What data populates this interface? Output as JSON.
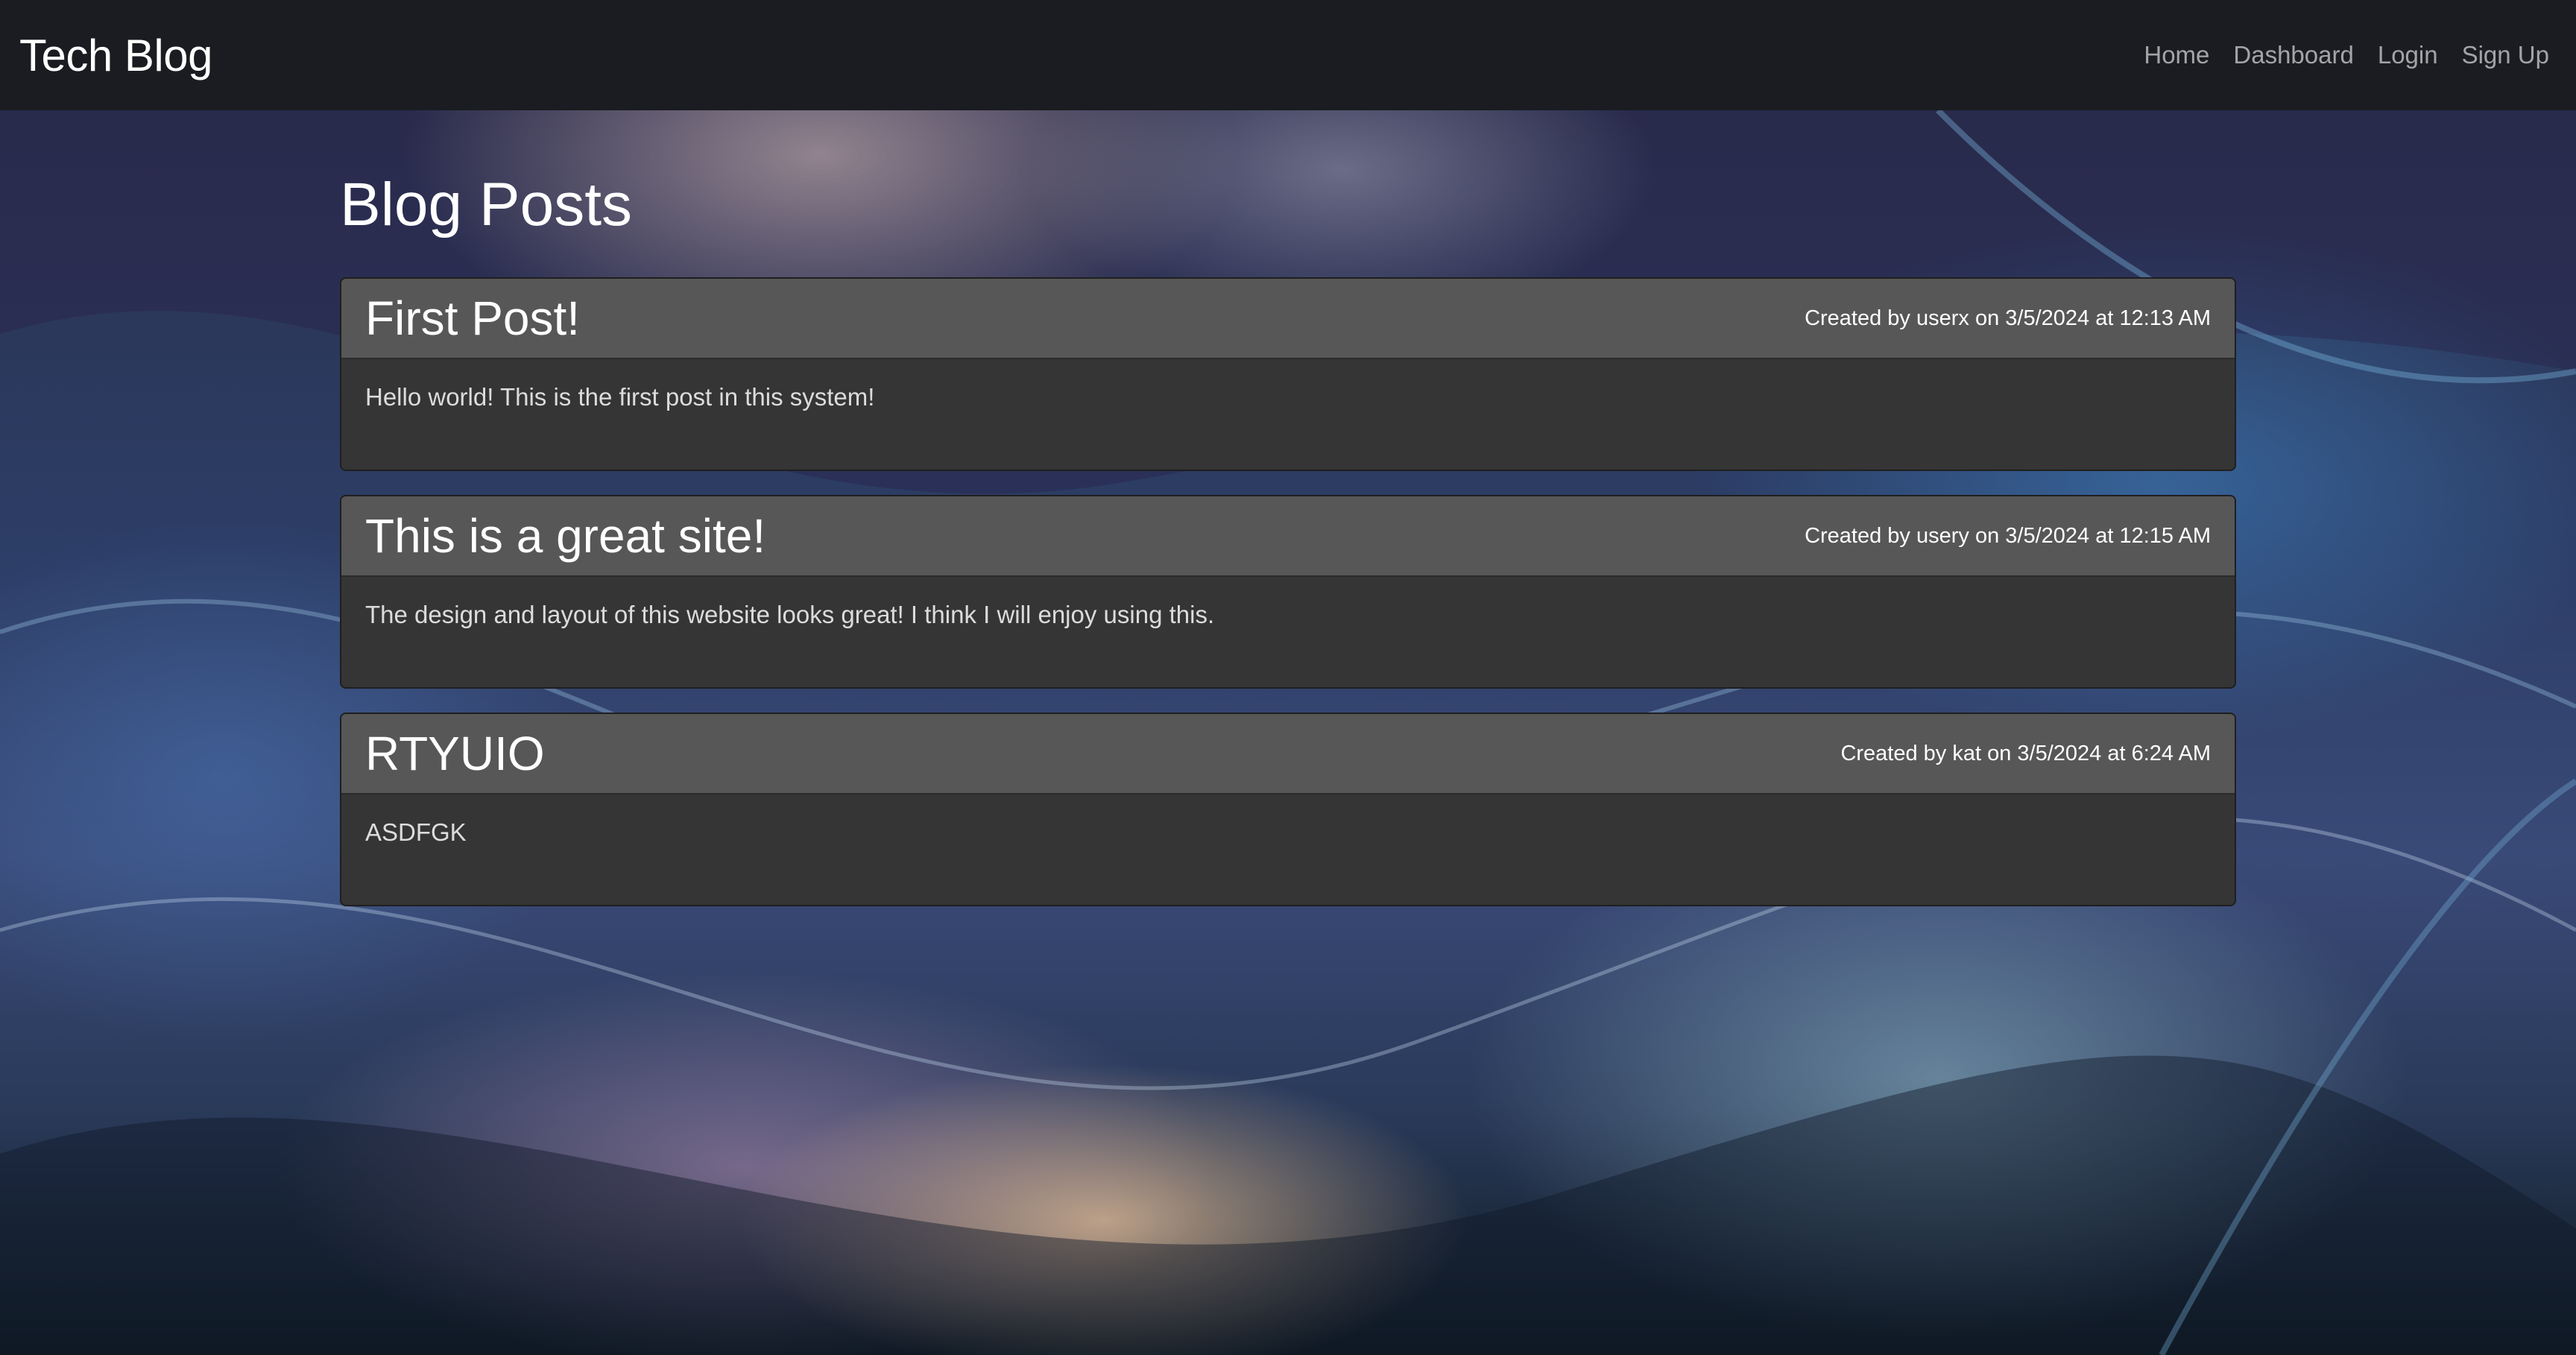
{
  "navbar": {
    "brand": "Tech Blog",
    "links": [
      "Home",
      "Dashboard",
      "Login",
      "Sign Up"
    ]
  },
  "main": {
    "title": "Blog Posts",
    "posts": [
      {
        "title": "First Post!",
        "meta": "Created by userx on 3/5/2024 at 12:13 AM",
        "body": "Hello world! This is the first post in this system!"
      },
      {
        "title": "This is a great site!",
        "meta": "Created by usery on 3/5/2024 at 12:15 AM",
        "body": "The design and layout of this website looks great! I think I will enjoy using this."
      },
      {
        "title": "RTYUIO",
        "meta": "Created by kat on 3/5/2024 at 6:24 AM",
        "body": "ASDFGK"
      }
    ]
  },
  "colors": {
    "navbar_bg": "#1a1c21",
    "card_header_bg": "#575757",
    "card_body_bg": "#353535"
  }
}
